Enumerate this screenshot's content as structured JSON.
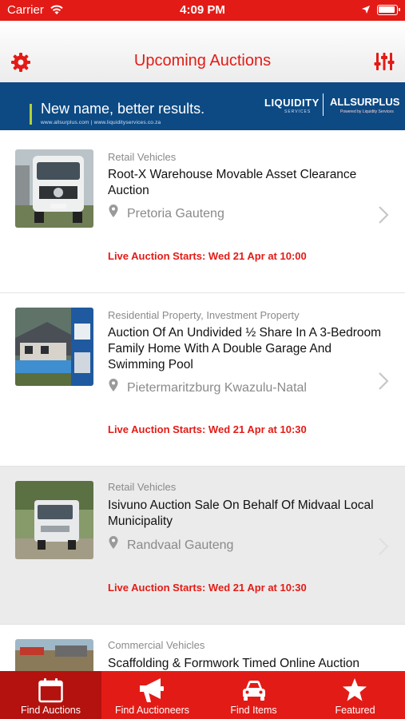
{
  "status_bar": {
    "carrier": "Carrier",
    "time": "4:09 PM"
  },
  "nav": {
    "title": "Upcoming Auctions"
  },
  "banner": {
    "tagline": "New name, better results.",
    "urls": "www.allsurplus.com   |   www.liquidityservices.co.za",
    "brand_primary": "LIQUIDITY",
    "brand_primary_sub": "SERVICES",
    "brand_secondary": "ALLSURPLUS",
    "brand_secondary_sub": "Powered by Liquidity Services"
  },
  "auctions": [
    {
      "category": "Retail Vehicles",
      "title": "Root-X Warehouse Movable Asset Clearance Auction",
      "location": "Pretoria Gauteng",
      "start": "Live Auction Starts: Wed 21 Apr at 10:00"
    },
    {
      "category": "Residential Property, Investment Property",
      "title": "Auction Of An Undivided ½ Share In A 3-Bedroom Family Home With A Double Garage And Swimming Pool",
      "location": "Pietermaritzburg Kwazulu-Natal",
      "start": "Live Auction Starts: Wed 21 Apr at 10:30"
    },
    {
      "category": "Retail Vehicles",
      "title": "Isivuno Auction Sale On Behalf Of Midvaal Local Municipality",
      "location": "Randvaal Gauteng",
      "start": "Live Auction Starts: Wed 21 Apr at 10:30"
    },
    {
      "category": "Commercial Vehicles",
      "title": "Scaffolding & Formwork Timed Online Auction",
      "location": "",
      "start": ""
    }
  ],
  "tabs": [
    {
      "label": "Find Auctions",
      "icon": "calendar-icon",
      "active": true
    },
    {
      "label": "Find Auctioneers",
      "icon": "megaphone-icon",
      "active": false
    },
    {
      "label": "Find Items",
      "icon": "car-icon",
      "active": false
    },
    {
      "label": "Featured",
      "icon": "star-icon",
      "active": false
    }
  ],
  "colors": {
    "brand_red": "#e31b16",
    "active_tab": "#b4120e",
    "banner_blue": "#0d4a84",
    "muted_text": "#8a8a8a"
  }
}
